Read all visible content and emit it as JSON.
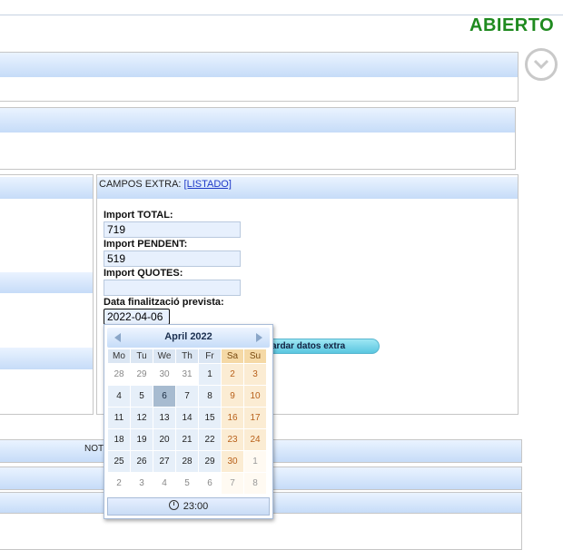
{
  "status": "ABIERTO",
  "extra": {
    "title": "CAMPOS EXTRA:",
    "listado": "[LISTADO]",
    "fields": [
      {
        "label": "Import TOTAL:",
        "value": "719"
      },
      {
        "label": "Import PENDENT:",
        "value": "519"
      },
      {
        "label": "Import QUOTES:",
        "value": ""
      }
    ],
    "date_label": "Data finalització prevista:",
    "date_value": "2022-04-06",
    "save_label": "ardar datos extra"
  },
  "notice_text": "NOT",
  "calendar": {
    "month_title": "April  2022",
    "dow": [
      "Mo",
      "Tu",
      "We",
      "Th",
      "Fr",
      "Sa",
      "Su"
    ],
    "weeks": [
      [
        "28",
        "29",
        "30",
        "31",
        "1",
        "2",
        "3"
      ],
      [
        "4",
        "5",
        "6",
        "7",
        "8",
        "9",
        "10"
      ],
      [
        "11",
        "12",
        "13",
        "14",
        "15",
        "16",
        "17"
      ],
      [
        "18",
        "19",
        "20",
        "21",
        "22",
        "23",
        "24"
      ],
      [
        "25",
        "26",
        "27",
        "28",
        "29",
        "30",
        "1"
      ],
      [
        "2",
        "3",
        "4",
        "5",
        "6",
        "7",
        "8"
      ]
    ],
    "selected": "6",
    "time": "23:00"
  }
}
